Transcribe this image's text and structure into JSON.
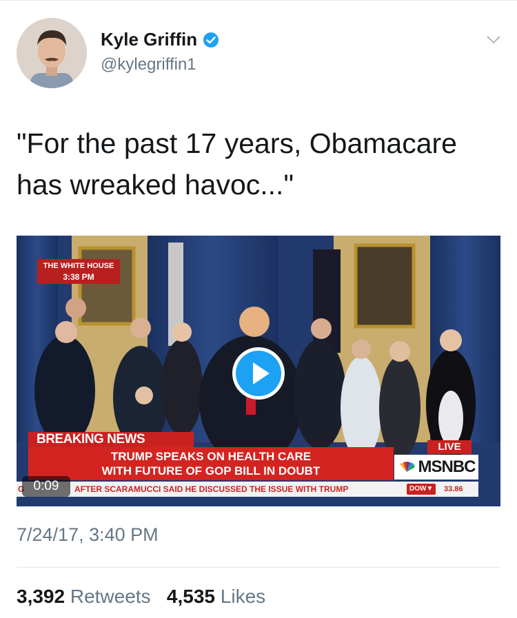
{
  "user": {
    "name": "Kyle Griffin",
    "handle": "@kylegriffin1"
  },
  "tweet": {
    "text_line1": "\"For the past 17 years, Obamacare",
    "text_line2": "has wreaked havoc...\"",
    "timestamp": "7/24/17, 3:40 PM"
  },
  "video": {
    "duration": "0:09",
    "location_label": "THE WHITE HOUSE",
    "location_time": "3:38 PM",
    "breaking_label": "BREAKING NEWS",
    "headline_line1": "TRUMP SPEAKS ON HEALTH CARE",
    "headline_line2": "WITH FUTURE OF GOP BILL IN DOUBT",
    "live_label": "LIVE",
    "network": "MSNBC",
    "ticker_prefix": "G",
    "ticker_text": "AFTER SCARAMUCCI SAID HE DISCUSSED THE ISSUE WITH TRUMP",
    "dow_label": "DOW▼",
    "dow_value": "33.86"
  },
  "stats": {
    "retweets_count": "3,392",
    "retweets_label": "Retweets",
    "likes_count": "4,535",
    "likes_label": "Likes"
  },
  "colors": {
    "verified_blue": "#1da1f2",
    "secondary_text": "#657786",
    "news_red": "#c9211f"
  },
  "icons": {
    "verified": "verified-badge-icon",
    "menu": "chevron-down-icon",
    "play": "play-icon"
  }
}
